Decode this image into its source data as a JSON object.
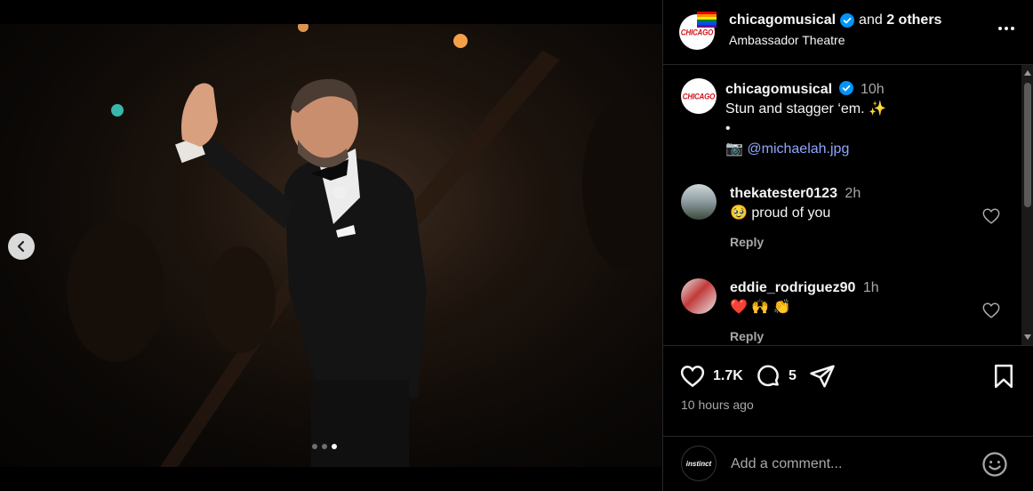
{
  "media": {
    "carousel_dots": 3,
    "active_index": 2
  },
  "header": {
    "username": "chicagomusical",
    "and_text": "and",
    "others": "2 others",
    "location": "Ambassador Theatre",
    "avatar_text": "CHICAGO"
  },
  "caption": {
    "username": "chicagomusical",
    "time": "10h",
    "line1": "Stun and stagger ‘em. ✨",
    "line2": "•",
    "camera": "📷",
    "mention": "@michaelah.jpg"
  },
  "comments": [
    {
      "username": "thekatester0123",
      "time": "2h",
      "text": "🥹 proud of you",
      "reply": "Reply"
    },
    {
      "username": "eddie_rodriguez90",
      "time": "1h",
      "text": "❤️ 🙌 👏",
      "reply": "Reply"
    }
  ],
  "actions": {
    "likes": "1.7K",
    "comments": "5",
    "posted": "10 hours ago"
  },
  "add_comment": {
    "placeholder": "Add a comment...",
    "avatar_text": "instinct"
  },
  "colors": {
    "verified": "#0095f6",
    "link": "#8fa6ff",
    "brand_red": "#d4111b"
  }
}
